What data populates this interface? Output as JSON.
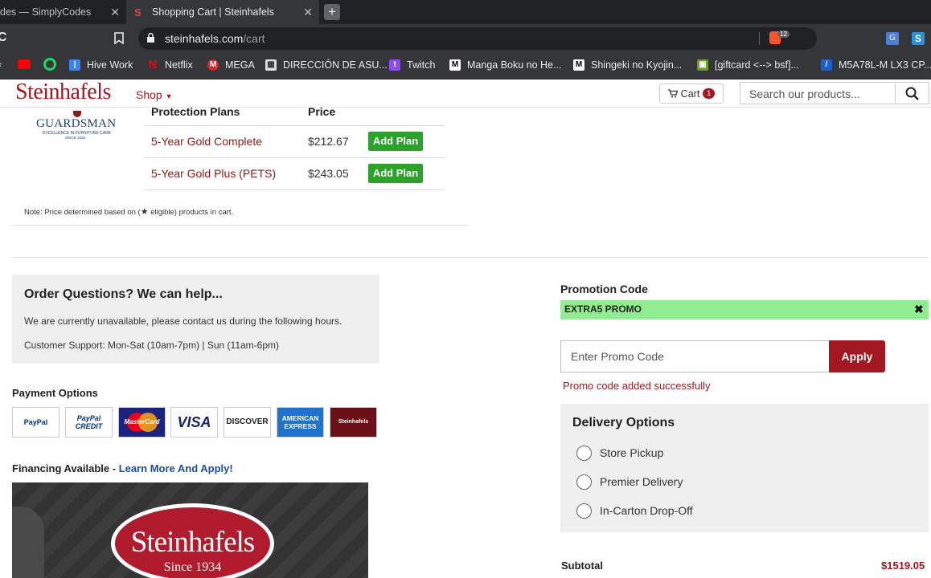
{
  "browser": {
    "tabs": [
      {
        "title": "des — SimplyCodes",
        "active": false
      },
      {
        "title": "Shopping Cart | Steinhafels",
        "active": true
      }
    ],
    "url_host": "steinhafels.com",
    "url_path": "/cart",
    "brave_badge": "12",
    "bookmarks": [
      "Hive Work",
      "Netflix",
      "MEGA",
      "DIRECCIÓN DE ASU...",
      "Twitch",
      "Manga Boku no He...",
      "Shingeki no Kyojin...",
      "[giftcard <--> bsf]...",
      "M5A78L-M LX3 CP..."
    ]
  },
  "header": {
    "logo": "Steinhafels",
    "shop_label": "Shop",
    "cart_label": "Cart",
    "cart_count": "1",
    "search_placeholder": "Search our products..."
  },
  "protection": {
    "brand": "GUARDSMAN",
    "brand_tagline": "EXCELLENCE IN FURNITURE CARE",
    "brand_since": "SINCE 1915",
    "col_plans": "Protection Plans",
    "col_price": "Price",
    "plans": [
      {
        "name": "5-Year Gold Complete",
        "price": "$212.67",
        "button": "Add Plan"
      },
      {
        "name": "5-Year Gold Plus (PETS)",
        "price": "$243.05",
        "button": "Add Plan"
      }
    ],
    "note_prefix": "Note: Price determined based on (",
    "note_star": "★",
    "note_suffix": " eligible) products in cart."
  },
  "questions": {
    "title": "Order Questions? We can help...",
    "line1": "We are currently unavailable, please contact us during the following hours.",
    "line2": "Customer Support: Mon-Sat (10am-7pm) | Sun (11am-6pm)"
  },
  "payment": {
    "title": "Payment Options",
    "cards": [
      "PayPal",
      "PayPal CREDIT",
      "MasterCard",
      "VISA",
      "DISCOVER",
      "AMERICAN EXPRESS",
      "Steinhafels"
    ]
  },
  "financing": {
    "label": "Financing Available - ",
    "link": "Learn More And Apply!",
    "banner_brand": "Steinhafels",
    "banner_since": "Since 1934"
  },
  "promo": {
    "title": "Promotion Code",
    "applied_code": "EXTRA5 PROMO",
    "remove_icon": "✖",
    "input_placeholder": "Enter Promo Code",
    "apply_label": "Apply",
    "message": "Promo code added successfully"
  },
  "delivery": {
    "title": "Delivery Options",
    "options": [
      "Store Pickup",
      "Premier Delivery",
      "In-Carton Drop-Off"
    ]
  },
  "summary": {
    "subtotal_label": "Subtotal",
    "subtotal_value": "$1519.05"
  },
  "colors": {
    "brand_red": "#a31820",
    "add_green": "#2ca22c",
    "promo_green": "#90ee90"
  }
}
